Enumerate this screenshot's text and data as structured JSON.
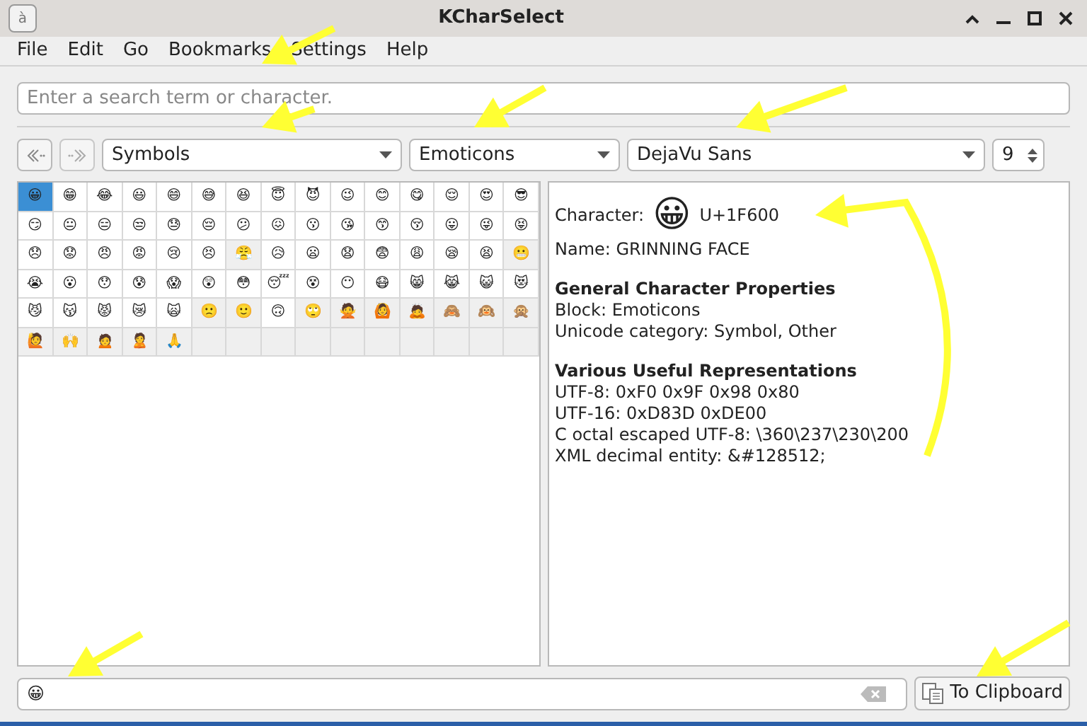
{
  "window": {
    "title": "KCharSelect",
    "app_icon": "à"
  },
  "menu": [
    "File",
    "Edit",
    "Go",
    "Bookmarks",
    "Settings",
    "Help"
  ],
  "search": {
    "placeholder": "Enter a search term or character."
  },
  "toolbar": {
    "section": "Symbols",
    "block": "Emoticons",
    "font": "DejaVu Sans",
    "size": "9"
  },
  "grid": [
    [
      {
        "char": "😀",
        "selected": true,
        "missing": false
      },
      {
        "char": "😁",
        "selected": false,
        "missing": false
      },
      {
        "char": "😂",
        "selected": false,
        "missing": false
      },
      {
        "char": "😃",
        "selected": false,
        "missing": false
      },
      {
        "char": "😄",
        "selected": false,
        "missing": false
      },
      {
        "char": "😅",
        "selected": false,
        "missing": false
      },
      {
        "char": "😆",
        "selected": false,
        "missing": false
      },
      {
        "char": "😇",
        "selected": false,
        "missing": false
      },
      {
        "char": "😈",
        "selected": false,
        "missing": false
      },
      {
        "char": "😉",
        "selected": false,
        "missing": false
      },
      {
        "char": "😊",
        "selected": false,
        "missing": false
      },
      {
        "char": "😋",
        "selected": false,
        "missing": false
      },
      {
        "char": "😌",
        "selected": false,
        "missing": false
      },
      {
        "char": "😍",
        "selected": false,
        "missing": false
      },
      {
        "char": "😎",
        "selected": false,
        "missing": false
      }
    ],
    [
      {
        "char": "😏",
        "selected": false,
        "missing": false
      },
      {
        "char": "😐",
        "selected": false,
        "missing": false
      },
      {
        "char": "😑",
        "selected": false,
        "missing": false
      },
      {
        "char": "😒",
        "selected": false,
        "missing": false
      },
      {
        "char": "😓",
        "selected": false,
        "missing": false
      },
      {
        "char": "😔",
        "selected": false,
        "missing": false
      },
      {
        "char": "😕",
        "selected": false,
        "missing": false
      },
      {
        "char": "😖",
        "selected": false,
        "missing": false
      },
      {
        "char": "😗",
        "selected": false,
        "missing": false
      },
      {
        "char": "😘",
        "selected": false,
        "missing": false
      },
      {
        "char": "😙",
        "selected": false,
        "missing": false
      },
      {
        "char": "😚",
        "selected": false,
        "missing": false
      },
      {
        "char": "😛",
        "selected": false,
        "missing": false
      },
      {
        "char": "😜",
        "selected": false,
        "missing": false
      },
      {
        "char": "😝",
        "selected": false,
        "missing": false
      }
    ],
    [
      {
        "char": "😞",
        "selected": false,
        "missing": false
      },
      {
        "char": "😟",
        "selected": false,
        "missing": false
      },
      {
        "char": "😠",
        "selected": false,
        "missing": false
      },
      {
        "char": "😡",
        "selected": false,
        "missing": false
      },
      {
        "char": "😢",
        "selected": false,
        "missing": false
      },
      {
        "char": "😣",
        "selected": false,
        "missing": false
      },
      {
        "char": "😤",
        "selected": false,
        "missing": true
      },
      {
        "char": "😥",
        "selected": false,
        "missing": false
      },
      {
        "char": "😦",
        "selected": false,
        "missing": false
      },
      {
        "char": "😧",
        "selected": false,
        "missing": false
      },
      {
        "char": "😨",
        "selected": false,
        "missing": false
      },
      {
        "char": "😩",
        "selected": false,
        "missing": false
      },
      {
        "char": "😪",
        "selected": false,
        "missing": false
      },
      {
        "char": "😫",
        "selected": false,
        "missing": false
      },
      {
        "char": "😬",
        "selected": false,
        "missing": true
      }
    ],
    [
      {
        "char": "😭",
        "selected": false,
        "missing": false
      },
      {
        "char": "😮",
        "selected": false,
        "missing": false
      },
      {
        "char": "😯",
        "selected": false,
        "missing": false
      },
      {
        "char": "😰",
        "selected": false,
        "missing": false
      },
      {
        "char": "😱",
        "selected": false,
        "missing": false
      },
      {
        "char": "😲",
        "selected": false,
        "missing": false
      },
      {
        "char": "😳",
        "selected": false,
        "missing": false
      },
      {
        "char": "😴",
        "selected": false,
        "missing": false
      },
      {
        "char": "😵",
        "selected": false,
        "missing": false
      },
      {
        "char": "😶",
        "selected": false,
        "missing": false
      },
      {
        "char": "😷",
        "selected": false,
        "missing": false
      },
      {
        "char": "😸",
        "selected": false,
        "missing": false
      },
      {
        "char": "😹",
        "selected": false,
        "missing": false
      },
      {
        "char": "😺",
        "selected": false,
        "missing": false
      },
      {
        "char": "😻",
        "selected": false,
        "missing": false
      }
    ],
    [
      {
        "char": "😼",
        "selected": false,
        "missing": false
      },
      {
        "char": "😽",
        "selected": false,
        "missing": false
      },
      {
        "char": "😾",
        "selected": false,
        "missing": false
      },
      {
        "char": "😿",
        "selected": false,
        "missing": false
      },
      {
        "char": "🙀",
        "selected": false,
        "missing": false
      },
      {
        "char": "🙁",
        "selected": false,
        "missing": true
      },
      {
        "char": "🙂",
        "selected": false,
        "missing": true
      },
      {
        "char": "🙃",
        "selected": false,
        "missing": false
      },
      {
        "char": "🙄",
        "selected": false,
        "missing": true
      },
      {
        "char": "🙅",
        "selected": false,
        "missing": true
      },
      {
        "char": "🙆",
        "selected": false,
        "missing": true
      },
      {
        "char": "🙇",
        "selected": false,
        "missing": true
      },
      {
        "char": "🙈",
        "selected": false,
        "missing": true
      },
      {
        "char": "🙉",
        "selected": false,
        "missing": true
      },
      {
        "char": "🙊",
        "selected": false,
        "missing": true
      }
    ],
    [
      {
        "char": "🙋",
        "selected": false,
        "missing": true
      },
      {
        "char": "🙌",
        "selected": false,
        "missing": true
      },
      {
        "char": "🙍",
        "selected": false,
        "missing": true
      },
      {
        "char": "🙎",
        "selected": false,
        "missing": true
      },
      {
        "char": "🙏",
        "selected": false,
        "missing": true
      }
    ]
  ],
  "details": {
    "character_label": "Character:",
    "character": "😀",
    "codepoint": "U+1F600",
    "name": "Name: GRINNING FACE",
    "sections": [
      {
        "heading": "General Character Properties",
        "lines": [
          "Block: Emoticons",
          "Unicode category: Symbol, Other"
        ]
      },
      {
        "heading": "Various Useful Representations",
        "lines": [
          "UTF-8: 0xF0 0x9F 0x98 0x80",
          "UTF-16: 0xD83D 0xDE00",
          "C octal escaped UTF-8: \\360\\237\\230\\200",
          "XML decimal entity: &#128512;"
        ]
      }
    ]
  },
  "bottom": {
    "text": "😀",
    "button": "To Clipboard"
  }
}
